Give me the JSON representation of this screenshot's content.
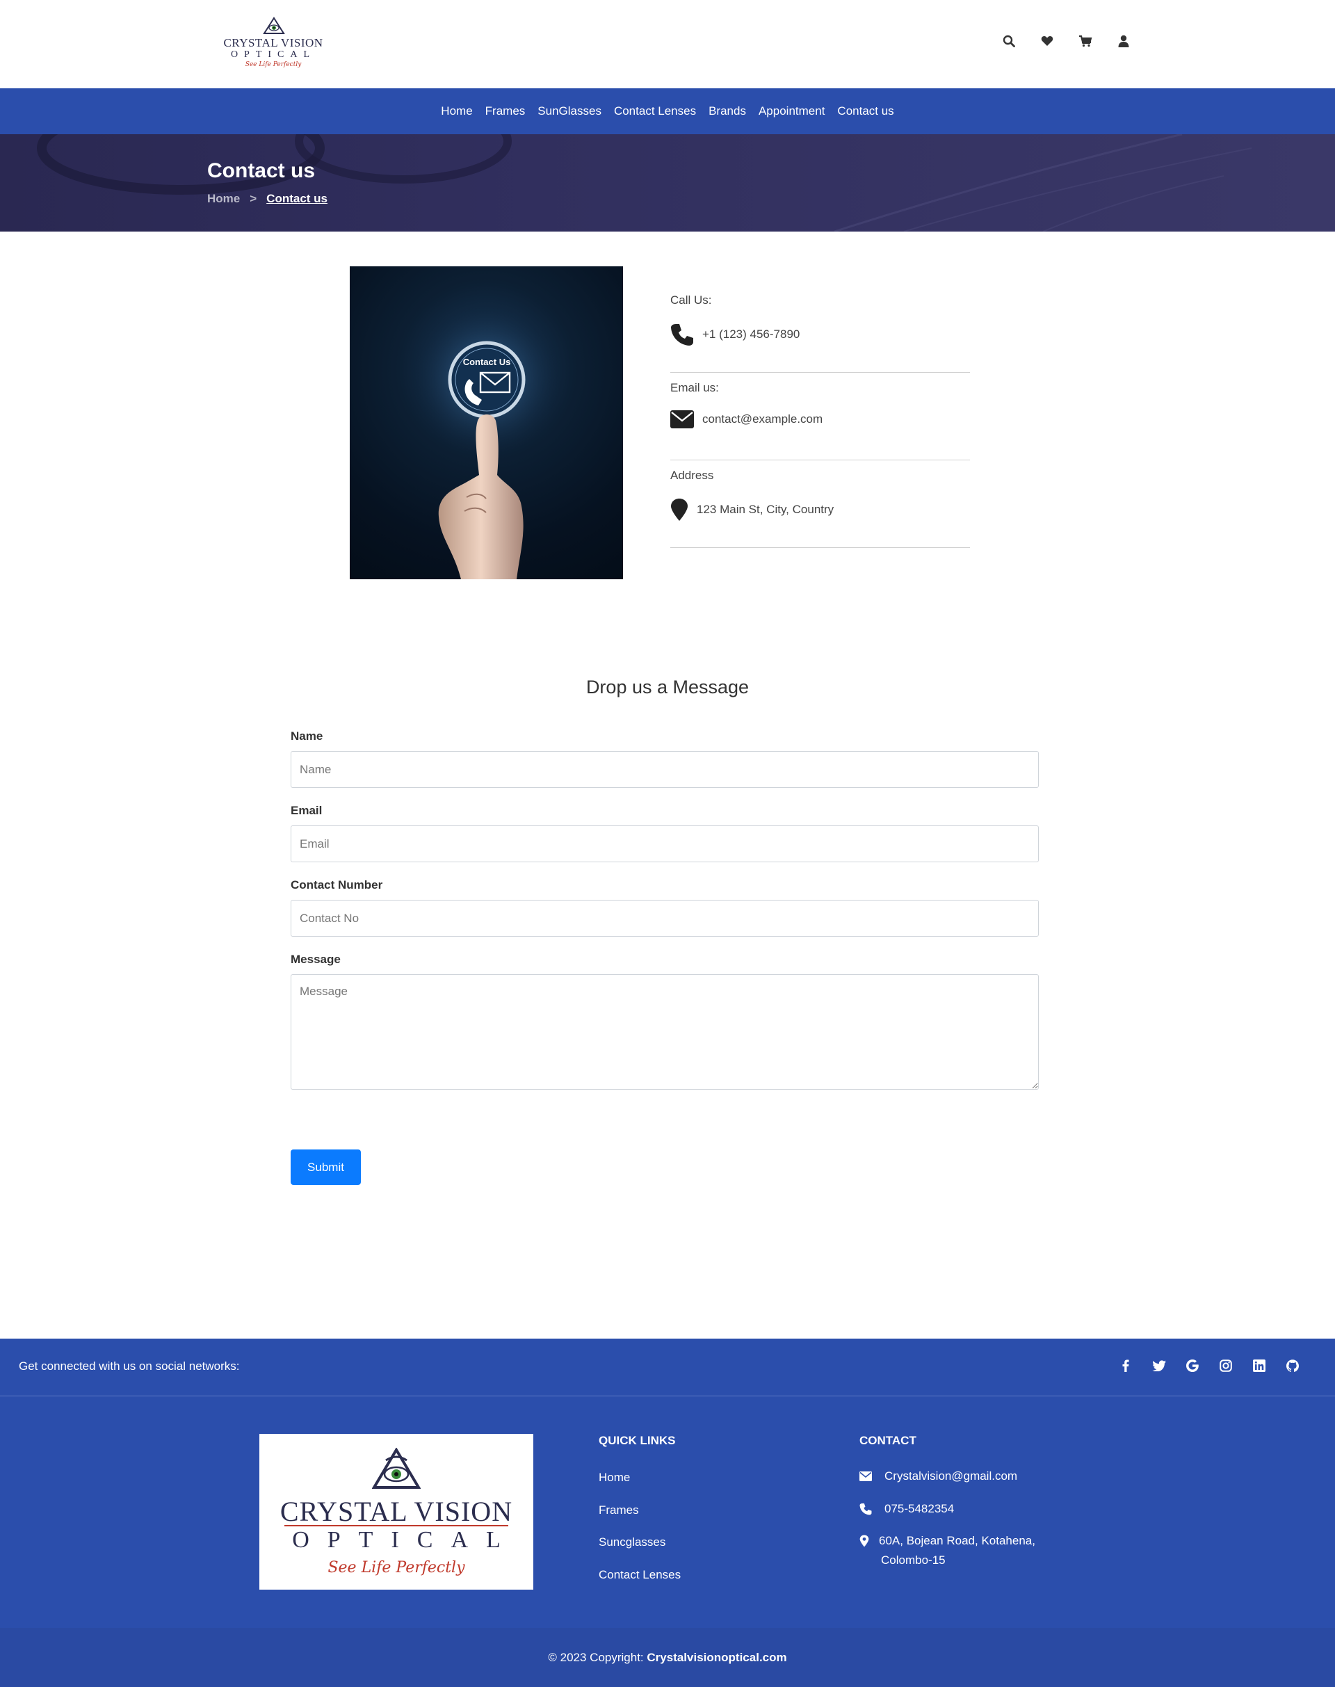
{
  "header": {
    "logo": {
      "line1": "CRYSTAL VISION",
      "line2": "OPTICAL",
      "tagline": "See Life Perfectly"
    },
    "icons": [
      "search-icon",
      "heart-icon",
      "cart-icon",
      "user-icon"
    ]
  },
  "nav": {
    "items": [
      {
        "label": "Home"
      },
      {
        "label": "Frames"
      },
      {
        "label": "SunGlasses"
      },
      {
        "label": "Contact Lenses"
      },
      {
        "label": "Brands"
      },
      {
        "label": "Appointment"
      },
      {
        "label": "Contact us"
      }
    ]
  },
  "hero": {
    "title": "Contact us",
    "breadcrumb": {
      "home": "Home",
      "separator": ">",
      "current": "Contact us"
    }
  },
  "contact_image": {
    "badge_text": "Contact Us"
  },
  "info": {
    "call": {
      "label": "Call Us:",
      "value": "+1 (123) 456-7890"
    },
    "email": {
      "label": "Email us:",
      "value": "contact@example.com"
    },
    "address": {
      "label": "Address",
      "value": "123 Main St, City, Country"
    }
  },
  "form": {
    "title": "Drop us a Message",
    "name": {
      "label": "Name",
      "placeholder": "Name"
    },
    "email": {
      "label": "Email",
      "placeholder": "Email"
    },
    "contact": {
      "label": "Contact Number",
      "placeholder": "Contact No"
    },
    "message": {
      "label": "Message",
      "placeholder": "Message"
    },
    "submit_label": "Submit"
  },
  "footer": {
    "social_text": "Get connected with us on social networks:",
    "social_icons": [
      "facebook-icon",
      "twitter-icon",
      "google-icon",
      "instagram-icon",
      "linkedin-icon",
      "github-icon"
    ],
    "logo": {
      "line1": "CRYSTAL VISION",
      "line2": "OPTICAL",
      "tagline": "See Life Perfectly"
    },
    "quick_links": {
      "title": "QUICK LINKS",
      "items": [
        "Home",
        "Frames",
        "Suncglasses",
        "Contact Lenses"
      ]
    },
    "contact": {
      "title": "CONTACT",
      "email": "Crystalvision@gmail.com",
      "phone": "075-5482354",
      "address_line1": "60A, Bojean Road, Kotahena,",
      "address_line2": "Colombo-15"
    },
    "copyright_prefix": "© 2023 Copyright:",
    "copyright_site": "Crystalvisionoptical.com"
  },
  "colors": {
    "nav_blue": "#2b4eac",
    "submit_blue": "#0b7bfe",
    "hero_bg": "#2a2852",
    "logo_red": "#c0392b"
  }
}
